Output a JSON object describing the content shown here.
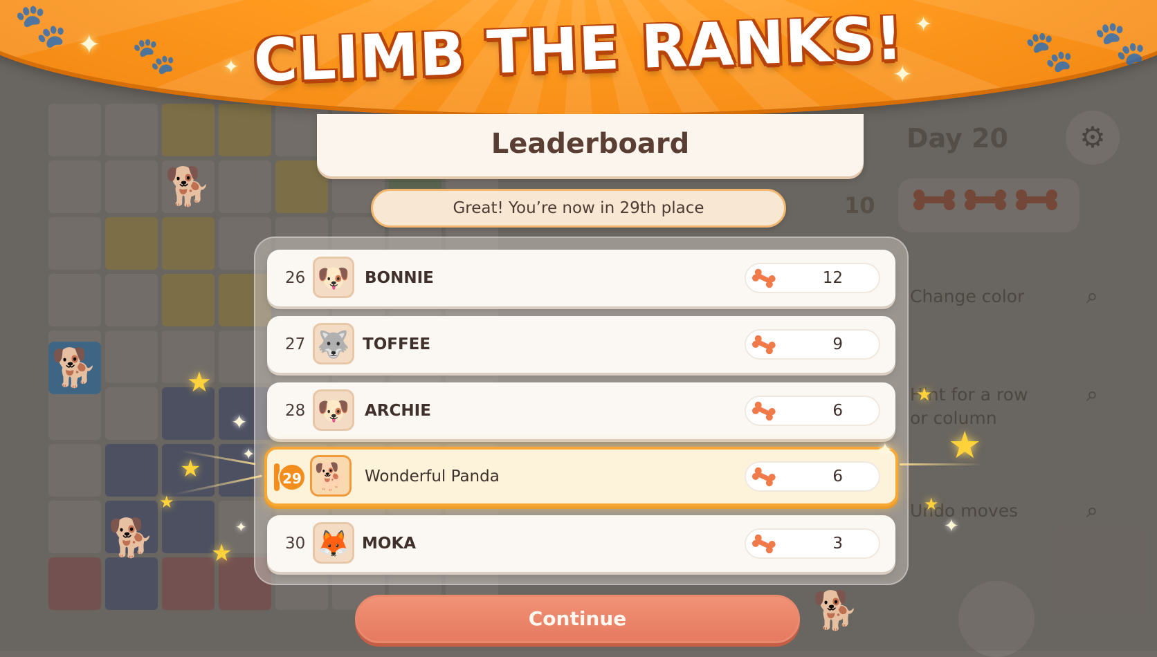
{
  "banner": {
    "title": "CLIMB THE RANKS!"
  },
  "leaderboard": {
    "title": "Leaderboard",
    "status_message": "Great! You’re now in 29th place",
    "entries": [
      {
        "rank": "26",
        "name": "BONNIE",
        "score": "12",
        "avatar": "golden-retriever-puppy"
      },
      {
        "rank": "27",
        "name": "TOFFEE",
        "score": "9",
        "avatar": "husky"
      },
      {
        "rank": "28",
        "name": "ARCHIE",
        "score": "6",
        "avatar": "pug"
      },
      {
        "rank": "29",
        "name": "Wonderful Panda",
        "score": "6",
        "avatar": "shiba-inu",
        "is_current_player": true
      },
      {
        "rank": "30",
        "name": "MOKA",
        "score": "3",
        "avatar": "corgi"
      }
    ]
  },
  "continue_label": "Continue",
  "background": {
    "day_label": "Day 20",
    "bone_count": "10",
    "tools": [
      {
        "label": "Change color"
      },
      {
        "label_line1": "Hint for a row",
        "label_line2": "or column"
      },
      {
        "label": "Undo moves"
      }
    ]
  },
  "colors": {
    "banner_orange": "#ff9a1f",
    "highlight_border": "#f8a634",
    "continue_button": "#e57a5f",
    "bone": "#f07a4a"
  }
}
